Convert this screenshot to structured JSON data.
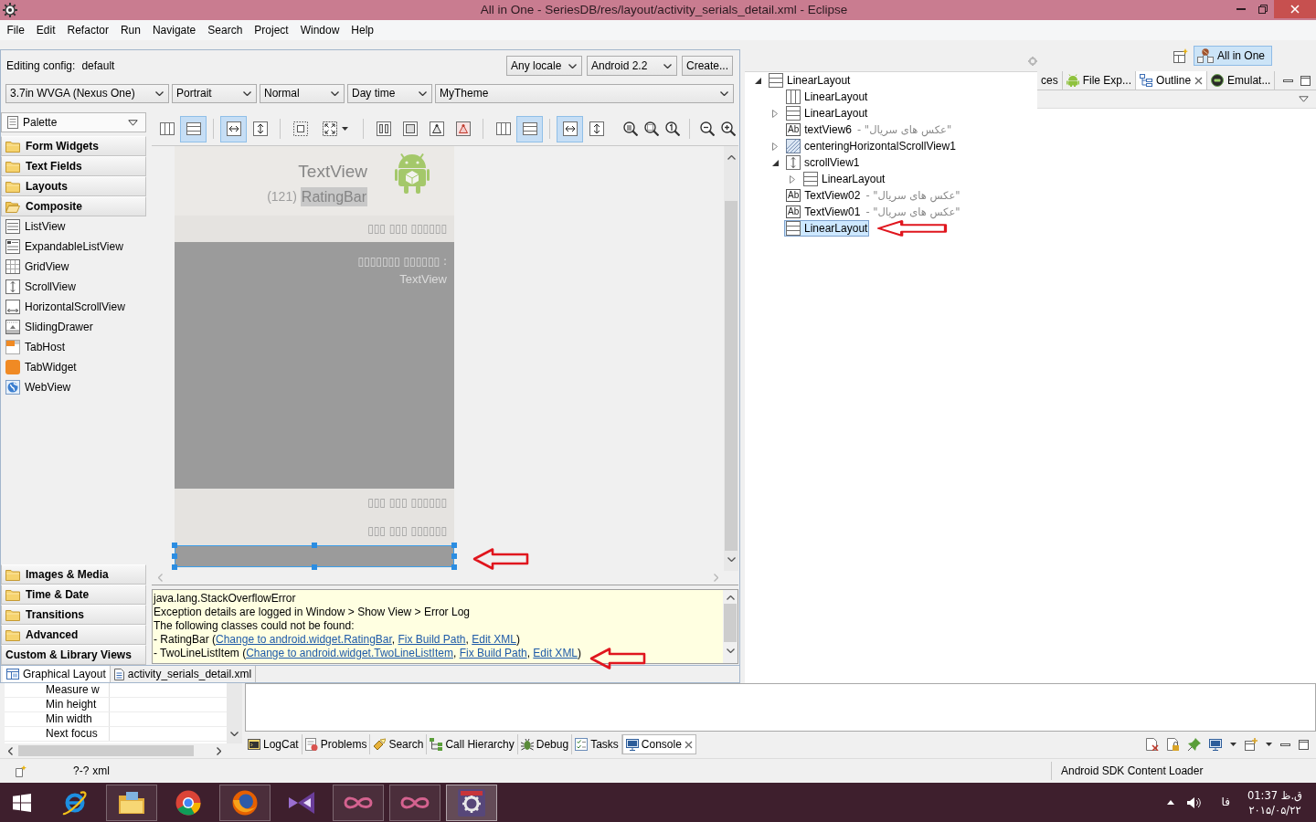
{
  "window": {
    "title": "All in One - SeriesDB/res/layout/activity_serials_detail.xml - Eclipse"
  },
  "menu": [
    "File",
    "Edit",
    "Refactor",
    "Run",
    "Navigate",
    "Search",
    "Project",
    "Window",
    "Help"
  ],
  "editor": {
    "config_label": "Editing config:",
    "config_value": "default",
    "locale": "Any locale",
    "target": "Android 2.2",
    "create_button": "Create...",
    "selectors": [
      "3.7in WVGA (Nexus One)",
      "Portrait",
      "Normal",
      "Day time",
      "MyTheme"
    ],
    "toolbar": [
      {
        "kind": "columns",
        "on": false
      },
      {
        "kind": "rows",
        "on": true
      },
      {
        "kind": "separator"
      },
      {
        "kind": "fill-width",
        "on": true
      },
      {
        "kind": "fill-height",
        "on": false
      },
      {
        "kind": "separator"
      },
      {
        "kind": "margins",
        "on": false
      },
      {
        "kind": "resize",
        "on": false
      },
      {
        "kind": "separator"
      },
      {
        "kind": "distribute",
        "on": false
      },
      {
        "kind": "inset",
        "on": false
      },
      {
        "kind": "anchor",
        "on": false
      },
      {
        "kind": "anchor-clear",
        "on": false
      },
      {
        "kind": "separator"
      },
      {
        "kind": "columns",
        "on": false
      },
      {
        "kind": "rows",
        "on": true
      },
      {
        "kind": "separator"
      },
      {
        "kind": "fill-width",
        "on": true
      },
      {
        "kind": "fill-height",
        "on": false
      },
      {
        "kind": "zoom-fit",
        "on": false
      },
      {
        "kind": "zoom-real",
        "on": false
      },
      {
        "kind": "zoom-reset",
        "on": false
      },
      {
        "kind": "separator"
      },
      {
        "kind": "zoom-out",
        "on": false
      },
      {
        "kind": "zoom-in",
        "on": false
      }
    ],
    "preview": {
      "title": "TextView",
      "count": "(121)",
      "rating": "RatingBar",
      "band": "▯▯▯ ▯▯▯ ▯▯▯▯▯▯",
      "panel_label": "▯▯▯▯▯▯▯ ▯▯▯▯▯▯ :",
      "panel_value": "TextView",
      "lines": [
        "▯▯▯ ▯▯▯ ▯▯▯▯▯▯",
        "▯▯▯ ▯▯▯ ▯▯▯▯▯▯"
      ],
      "bar_selected": true
    },
    "error_log": [
      [
        {
          "kind": "text",
          "text": "java.lang.StackOverflowError"
        }
      ],
      [
        {
          "kind": "text",
          "text": "Exception details are logged in Window > Show View > Error Log"
        }
      ],
      [
        {
          "kind": "text",
          "text": "The following classes could not be found:"
        }
      ],
      [
        {
          "kind": "text",
          "text": "- RatingBar ("
        },
        {
          "kind": "link",
          "text": "Change to android.widget.RatingBar"
        },
        {
          "kind": "text",
          "text": ", "
        },
        {
          "kind": "link",
          "text": "Fix Build Path"
        },
        {
          "kind": "text",
          "text": ", "
        },
        {
          "kind": "link",
          "text": "Edit XML"
        },
        {
          "kind": "text",
          "text": ")"
        }
      ],
      [
        {
          "kind": "text",
          "text": "- TwoLineListItem ("
        },
        {
          "kind": "link",
          "text": "Change to android.widget.TwoLineListItem"
        },
        {
          "kind": "text",
          "text": ", "
        },
        {
          "kind": "link",
          "text": "Fix Build Path"
        },
        {
          "kind": "text",
          "text": ", "
        },
        {
          "kind": "link",
          "text": "Edit XML"
        },
        {
          "kind": "text",
          "text": ")"
        }
      ]
    ],
    "tabs": [
      {
        "label": "Graphical Layout",
        "selected": true
      },
      {
        "label": "activity_serials_detail.xml",
        "selected": false
      }
    ]
  },
  "palette": {
    "title": "Palette",
    "categories": [
      {
        "label": "Form Widgets",
        "kind": "folder",
        "expanded": false
      },
      {
        "label": "Text Fields",
        "kind": "folder",
        "expanded": false
      },
      {
        "label": "Layouts",
        "kind": "folder",
        "expanded": false
      },
      {
        "label": "Composite",
        "kind": "folder",
        "expanded": true,
        "items": [
          {
            "label": "ListView",
            "kind": "list"
          },
          {
            "label": "ExpandableListView",
            "kind": "expandable-list"
          },
          {
            "label": "GridView",
            "kind": "grid"
          },
          {
            "label": "ScrollView",
            "kind": "scroll"
          },
          {
            "label": "HorizontalScrollView",
            "kind": "hscroll"
          },
          {
            "label": "SlidingDrawer",
            "kind": "drawer"
          },
          {
            "label": "TabHost",
            "kind": "tabhost"
          },
          {
            "label": "TabWidget",
            "kind": "tabwidget"
          },
          {
            "label": "WebView",
            "kind": "web"
          }
        ]
      },
      {
        "label": "Images & Media",
        "kind": "folder",
        "expanded": false
      },
      {
        "label": "Time & Date",
        "kind": "folder",
        "expanded": false
      },
      {
        "label": "Transitions",
        "kind": "folder",
        "expanded": false
      },
      {
        "label": "Advanced",
        "kind": "folder",
        "expanded": false
      },
      {
        "label": "Custom & Library Views",
        "kind": "plain",
        "expanded": false
      }
    ]
  },
  "perspective": {
    "label": "All in One",
    "on": true
  },
  "outline": {
    "tabs": [
      {
        "label": "ces",
        "kind": "plain",
        "selected": false
      },
      {
        "label": "File Exp...",
        "kind": "robot",
        "selected": false
      },
      {
        "label": "Outline",
        "kind": "outline",
        "selected": true
      },
      {
        "label": "Emulat...",
        "kind": "emulator",
        "selected": false
      }
    ],
    "tree": [
      {
        "name": "LinearLayout",
        "kind": "rows",
        "expanded": true,
        "selected": false,
        "children": [
          {
            "name": "LinearLayout",
            "kind": "columns",
            "selected": false
          },
          {
            "name": "LinearLayout",
            "kind": "rows",
            "expanded": false,
            "selected": false
          },
          {
            "name": "textView6",
            "kind": "text",
            "badge": "Ab",
            "detail": "- \"عکس های سریال\"",
            "selected": false
          },
          {
            "name": "centeringHorizontalScrollView1",
            "kind": "hatched",
            "expanded": false,
            "selected": false
          },
          {
            "name": "scrollView1",
            "kind": "scroll",
            "expanded": true,
            "selected": false,
            "children": [
              {
                "name": "LinearLayout",
                "kind": "rows",
                "expanded": false,
                "selected": false
              }
            ]
          },
          {
            "name": "TextView02",
            "kind": "text",
            "badge": "Ab",
            "detail": "- \"عکس های سریال\"",
            "selected": false
          },
          {
            "name": "TextView01",
            "kind": "text",
            "badge": "Ab",
            "detail": "- \"عکس های سریال\"",
            "selected": false
          },
          {
            "name": "LinearLayout",
            "kind": "rows",
            "selected": true
          }
        ]
      }
    ]
  },
  "properties": [
    "Measure w",
    "Min height",
    "Min width",
    "Next focus"
  ],
  "console": {
    "tabs": [
      {
        "label": "LogCat",
        "kind": "logcat",
        "selected": false
      },
      {
        "label": "Problems",
        "kind": "problems",
        "selected": false
      },
      {
        "label": "Search",
        "kind": "search",
        "selected": false
      },
      {
        "label": "Call Hierarchy",
        "kind": "hierarchy",
        "selected": false
      },
      {
        "label": "Debug",
        "kind": "debug",
        "selected": false
      },
      {
        "label": "Tasks",
        "kind": "tasks",
        "selected": false
      },
      {
        "label": "Console",
        "kind": "console",
        "selected": true
      }
    ]
  },
  "status_bar": {
    "texts": [
      "?-?",
      "xml"
    ],
    "task": "Android SDK Content Loader"
  },
  "taskbar": {
    "apps": [
      {
        "kind": "ring",
        "open": false,
        "active": false
      },
      {
        "kind": "folder",
        "open": true,
        "active": false
      },
      {
        "kind": "tricolor",
        "open": false,
        "active": false
      },
      {
        "kind": "flame",
        "open": true,
        "active": false
      },
      {
        "kind": "bowtie",
        "open": false,
        "active": false
      },
      {
        "kind": "infinity",
        "open": true,
        "active": false
      },
      {
        "kind": "infinity",
        "open": true,
        "active": false
      },
      {
        "kind": "gear",
        "open": true,
        "active": true
      }
    ],
    "language": "فا",
    "time": "01:37 ق.ظ",
    "date": "۲۰۱۵/۰۵/۲۲"
  }
}
